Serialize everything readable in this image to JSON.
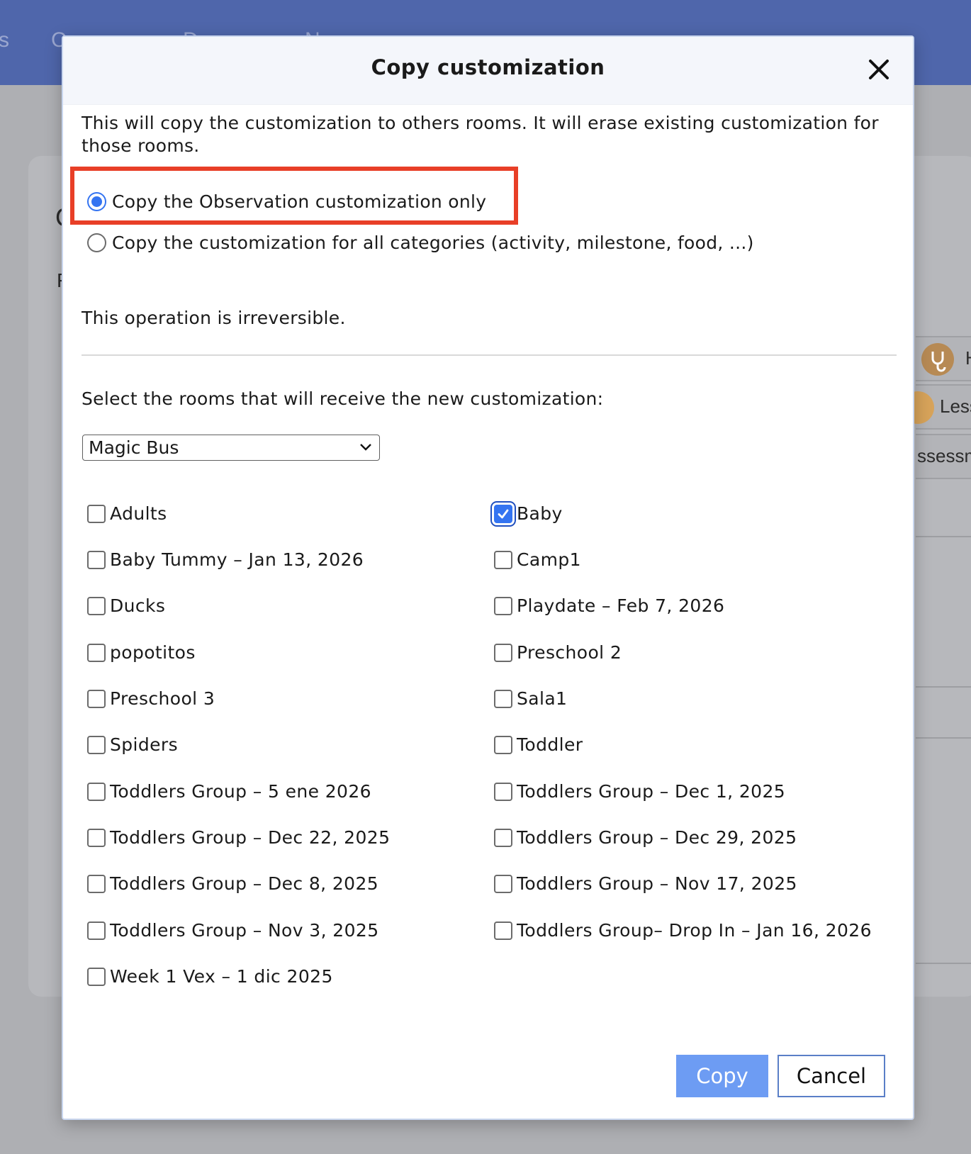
{
  "background": {
    "nav_items": [
      "s",
      "C",
      "D",
      "N"
    ],
    "card_letters": [
      "C",
      "F"
    ],
    "right_pills": [
      {
        "label": "H",
        "icon": "stethoscope-icon"
      },
      {
        "label": "Less",
        "icon": "badge-icon"
      },
      {
        "label": "ssessm",
        "icon": ""
      }
    ]
  },
  "modal": {
    "title": "Copy customization",
    "close_icon": "close-icon",
    "intro": "This will copy the customization to others rooms. It will erase existing customization for those rooms.",
    "options": [
      {
        "label": "Copy the Observation customization only",
        "selected": true
      },
      {
        "label": "Copy the customization for all categories (activity, milestone, food, ...)",
        "selected": false
      }
    ],
    "irreversible": "This operation is irreversible.",
    "select_label": "Select the rooms that will receive the new customization:",
    "school_select": {
      "value": "Magic Bus"
    },
    "rooms": [
      {
        "label": "Adults",
        "checked": false
      },
      {
        "label": "Baby",
        "checked": true
      },
      {
        "label": "Baby Tummy – Jan 13, 2026",
        "checked": false
      },
      {
        "label": "Camp1",
        "checked": false
      },
      {
        "label": "Ducks",
        "checked": false
      },
      {
        "label": "Playdate – Feb 7, 2026",
        "checked": false
      },
      {
        "label": "popotitos",
        "checked": false
      },
      {
        "label": "Preschool 2",
        "checked": false
      },
      {
        "label": "Preschool 3",
        "checked": false
      },
      {
        "label": "Sala1",
        "checked": false
      },
      {
        "label": "Spiders",
        "checked": false
      },
      {
        "label": "Toddler",
        "checked": false
      },
      {
        "label": "Toddlers Group – 5 ene 2026",
        "checked": false
      },
      {
        "label": "Toddlers Group – Dec 1, 2025",
        "checked": false
      },
      {
        "label": "Toddlers Group – Dec 22, 2025",
        "checked": false
      },
      {
        "label": "Toddlers Group – Dec 29, 2025",
        "checked": false
      },
      {
        "label": "Toddlers Group – Dec 8, 2025",
        "checked": false
      },
      {
        "label": "Toddlers Group – Nov 17, 2025",
        "checked": false
      },
      {
        "label": "Toddlers Group – Nov 3, 2025",
        "checked": false
      },
      {
        "label": "Toddlers Group– Drop In – Jan 16, 2026",
        "checked": false
      },
      {
        "label": "Week 1 Vex – 1 dic 2025",
        "checked": false
      }
    ],
    "buttons": {
      "copy": "Copy",
      "cancel": "Cancel"
    },
    "colors": {
      "accent": "#3474f1",
      "highlight_border": "#e83f27",
      "copy_button": "#6d9cf3",
      "topbar": "#4f66ab"
    }
  }
}
